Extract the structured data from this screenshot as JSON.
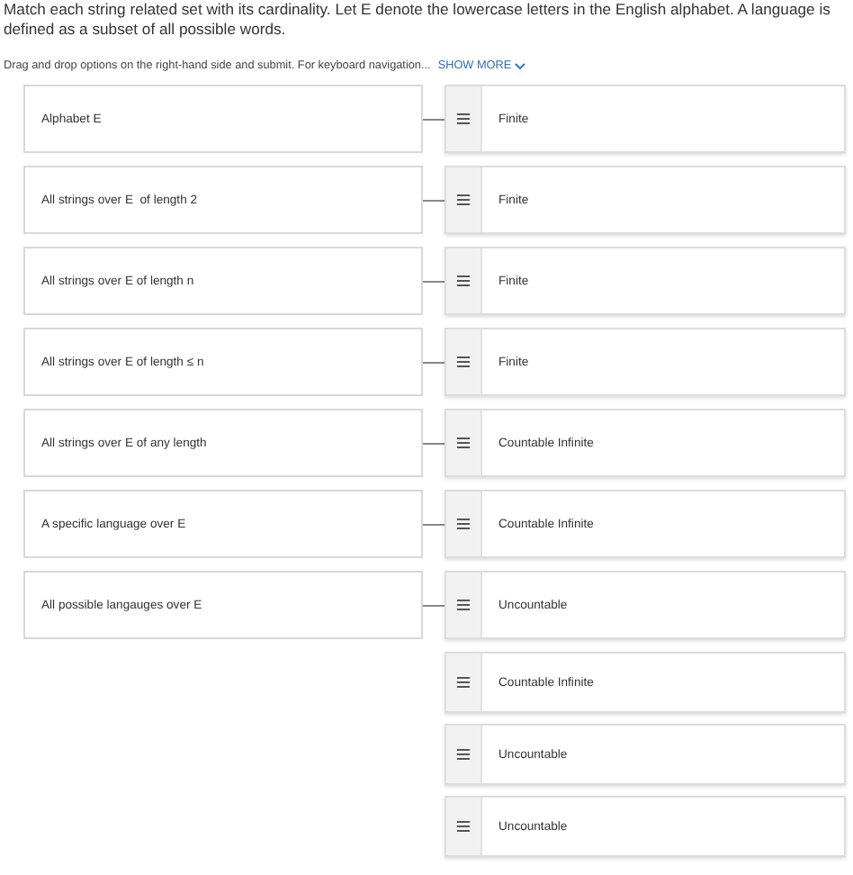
{
  "question": "Match each string related set with its cardinality. Let E denote the lowercase letters in the English alphabet. A language is defined as a subset of all possible words.",
  "instructions": {
    "text": "Drag and drop options on the right-hand side and submit. For keyboard navigation...",
    "link": "SHOW MORE"
  },
  "pairs": [
    {
      "prompt": "Alphabet E",
      "answer": "Finite"
    },
    {
      "prompt": "All strings over E  of length 2",
      "answer": "Finite"
    },
    {
      "prompt": "All strings over E of length n",
      "answer": "Finite"
    },
    {
      "prompt": "All strings over E of length ≤ n",
      "answer": "Finite"
    },
    {
      "prompt": "All strings over E of any length",
      "answer": "Countable Infinite"
    },
    {
      "prompt": "A specific language over E",
      "answer": "Countable Infinite"
    },
    {
      "prompt": "All possible langauges over E",
      "answer": "Uncountable"
    }
  ],
  "extra_options": [
    "Countable Infinite",
    "Uncountable",
    "Uncountable"
  ]
}
